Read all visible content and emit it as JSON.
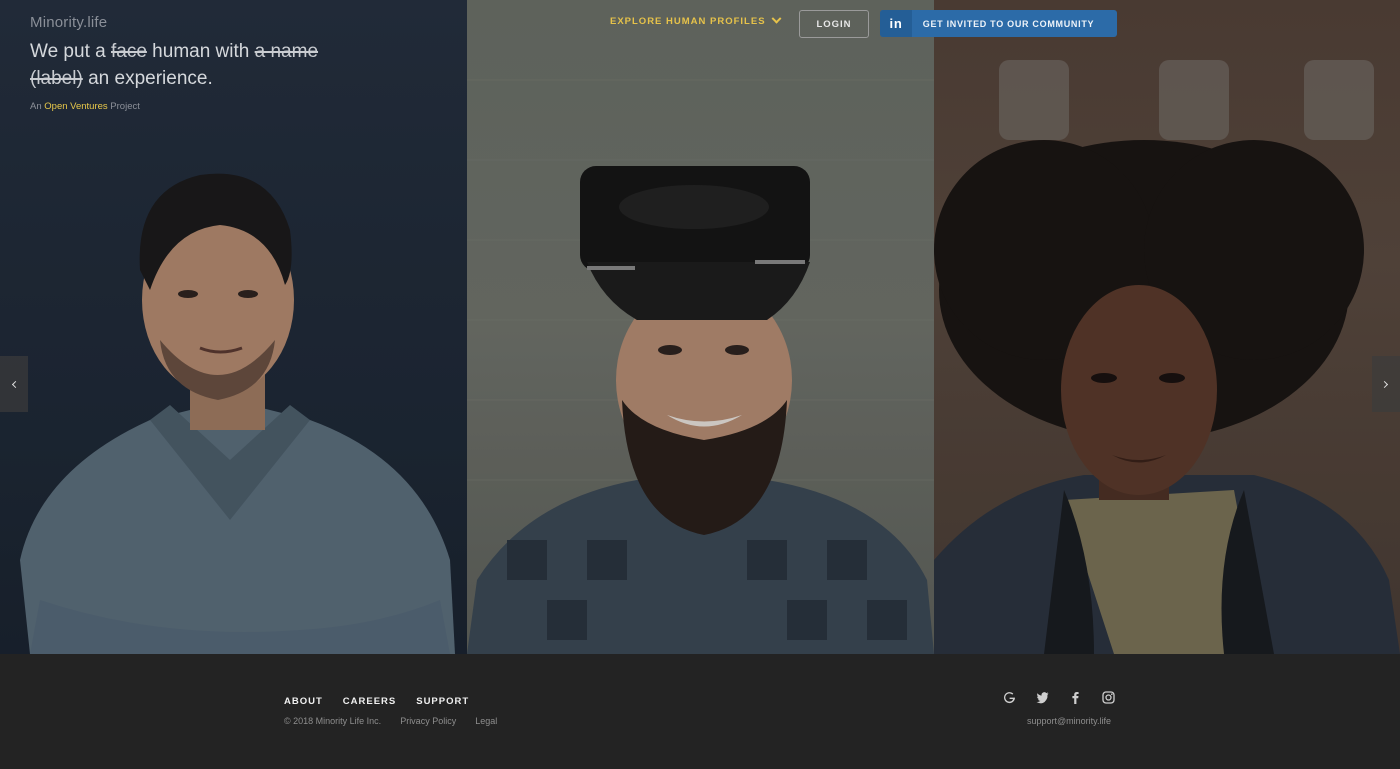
{
  "brand": "Minority.life",
  "tagline": {
    "p1": "We put a ",
    "s1": "face",
    "p2": " human with ",
    "s2": "a name",
    "s3": "(label)",
    "p3": " an experience."
  },
  "credit": {
    "an": "An",
    "open": "Open",
    "ventures": "Ventures",
    "project": "Project"
  },
  "nav": {
    "explore": "EXPLORE HUMAN PROFILES",
    "login": "LOGIN",
    "invite_icon": "in",
    "invite": "GET INVITED TO OUR COMMUNITY"
  },
  "footer": {
    "links": [
      "ABOUT",
      "CAREERS",
      "SUPPORT"
    ],
    "copyright": "© 2018 Minority Life Inc.",
    "privacy": "Privacy Policy",
    "legal": "Legal",
    "email": "support@minority.life",
    "social": [
      "google-icon",
      "twitter-icon",
      "facebook-icon",
      "instagram-icon"
    ]
  },
  "colors": {
    "accent": "#e6c24a",
    "button_blue": "#2c6ba8",
    "footer_bg": "#232323"
  }
}
